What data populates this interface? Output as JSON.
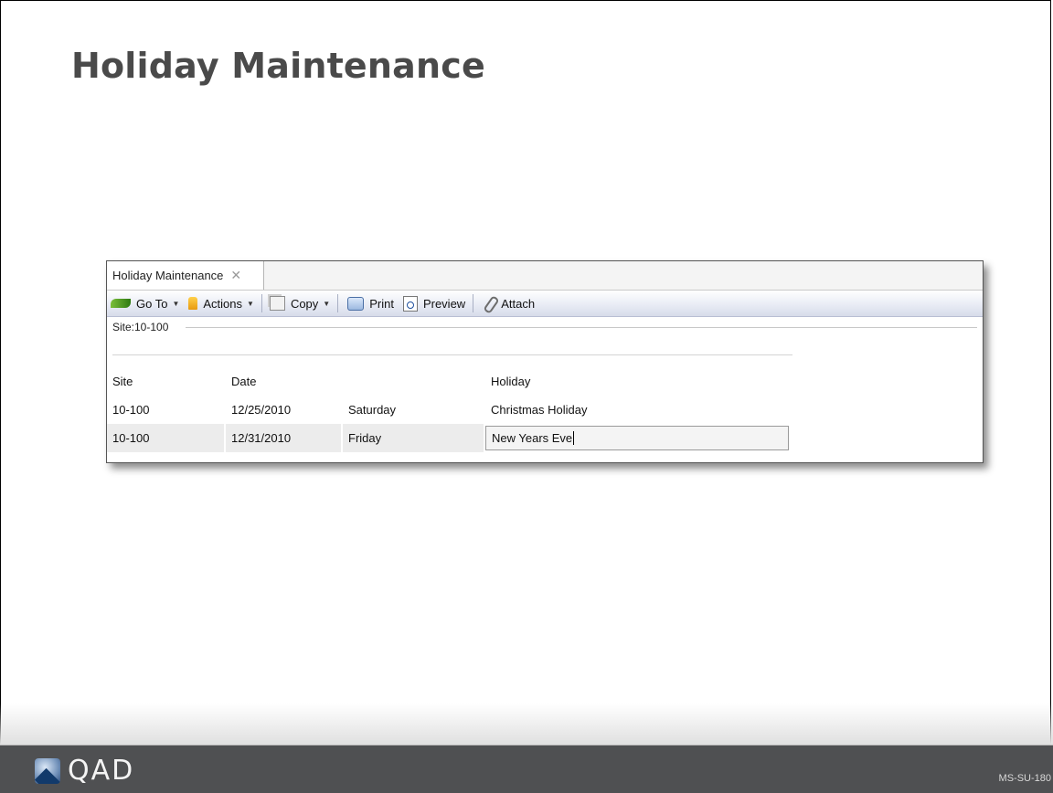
{
  "slide": {
    "title": "Holiday Maintenance",
    "code": "MS-SU-180",
    "logo_text": "QAD"
  },
  "window": {
    "tab": {
      "label": "Holiday Maintenance",
      "close_glyph": "✕"
    },
    "toolbar": {
      "goto_label": "Go To",
      "actions_label": "Actions",
      "copy_label": "Copy",
      "print_label": "Print",
      "preview_label": "Preview",
      "attach_label": "Attach",
      "icons": [
        "goto-icon",
        "actions-icon",
        "copy-icon",
        "print-icon",
        "preview-icon",
        "attach-icon"
      ]
    },
    "site_caption": "Site:10-100",
    "grid": {
      "headers": {
        "site": "Site",
        "date": "Date",
        "day": "",
        "holiday": "Holiday"
      },
      "rows": [
        {
          "site": "10-100",
          "date": "12/25/2010",
          "day": "Saturday",
          "holiday": "Christmas Holiday"
        },
        {
          "site": "10-100",
          "date": "12/31/2010",
          "day": "Friday",
          "holiday": "New Years Eve"
        }
      ]
    }
  },
  "colors": {
    "title": "#4a4a4a",
    "footer": "#4f5052",
    "toolbar_end": "#d7dcea"
  }
}
